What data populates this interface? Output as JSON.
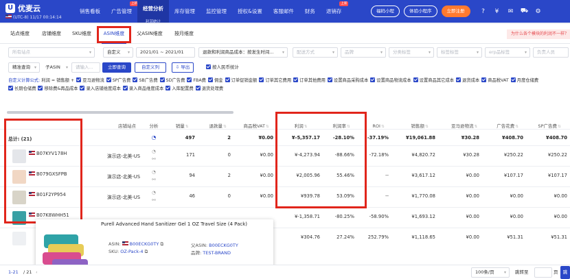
{
  "app": {
    "logo": "优麦云",
    "region_time": "(UTC-8) 11/17 00:14:14",
    "nav": [
      {
        "label": "销售看板"
      },
      {
        "label": "广告管理",
        "tag": "上新"
      },
      {
        "label": "经营分析",
        "sub": "利润统计",
        "active": true
      },
      {
        "label": "库存管理"
      },
      {
        "label": "监控管理"
      },
      {
        "label": "授权&设置"
      },
      {
        "label": "客服邮件"
      },
      {
        "label": "财务"
      },
      {
        "label": "退销存",
        "tag": "上新"
      }
    ],
    "mini_program_btn": "福码小程",
    "trial_btn": "体验小程序",
    "signup_btn": "立即注册"
  },
  "tabs": [
    "站点维度",
    "店铺维度",
    "SKU维度",
    "ASIN维度",
    "父ASIN维度",
    "按月维度"
  ],
  "active_tab": "ASIN维度",
  "help_link": "为什么各个模块的利润不一样？",
  "filters": {
    "site": "所有站点",
    "custom": "自定义",
    "date_from": "2021/01",
    "date_sep": "~",
    "date_to": "2021/01",
    "cost_mode": "退款和利润商品成本：按发生时间...",
    "ship_placeholder": "配送方式",
    "brand_placeholder": "品牌",
    "category_placeholder": "分类标签",
    "tag_placeholder": "标签标签",
    "erp_placeholder": "erp品标签",
    "owner_placeholder": "负责人员",
    "search_mode": "精准查询",
    "search_field": "子ASIN",
    "search_placeholder": "请输入...",
    "query_btn": "立即查询",
    "custom_col_btn": "自定义列",
    "export_btn": "导出",
    "by_asin_stats": "按人民币统计"
  },
  "formula": {
    "title": "自定义计算公式:",
    "items": [
      "利润 = 销售额 +",
      "亚马逊物流",
      "SP广告费",
      "SB广告费",
      "SD广告费",
      "FBA费",
      "佣金",
      "订单促销金额",
      "订单其它费用",
      "订单其他费用",
      "设置商品采购成本",
      "设置商品物流成本",
      "设置商品其它成本",
      "退货成本",
      "商品税VAT",
      "月度仓储费",
      "长期仓储费",
      "移除费&再品成本",
      "录入店铺维度成本",
      "录入商品维度成本",
      "入库配置费",
      "退货处理费"
    ]
  },
  "table": {
    "headers": [
      "",
      "店铺站点",
      "分析",
      "销量",
      "退款量",
      "商品税VAT",
      "利润",
      "利润率",
      "ROI",
      "销售额",
      "亚马逊物流",
      "广告花费",
      "SP广告费"
    ],
    "total_label": "总计: (21)",
    "total": {
      "sales_qty": "497",
      "refund_qty": "2",
      "vat": "¥0.00",
      "profit": "¥-5,357.17",
      "margin": "-28.10%",
      "roi": "-37.19%",
      "revenue": "¥19,061.88",
      "fba": "¥30.28",
      "ad_spend": "¥408.70",
      "sp": "¥408.70"
    },
    "rows": [
      {
        "asin": "B07KYV178H",
        "store": "演示店-北美-US",
        "qty": "171",
        "refund": "0",
        "vat": "¥0.00",
        "profit": "¥-4,273.94",
        "margin": "-88.66%",
        "roi": "-72.18%",
        "revenue": "¥4,820.72",
        "fba": "¥30.28",
        "ad": "¥250.22",
        "sp": "¥250.22"
      },
      {
        "asin": "B079GXSFPB",
        "store": "演示店-北美-US",
        "qty": "94",
        "refund": "2",
        "vat": "¥0.00",
        "profit": "¥2,005.96",
        "margin": "55.46%",
        "roi": "--",
        "revenue": "¥3,617.12",
        "fba": "¥0.00",
        "ad": "¥107.17",
        "sp": "¥107.17"
      },
      {
        "asin": "B01F2YP954",
        "store": "演示店-北美-US",
        "qty": "46",
        "refund": "0",
        "vat": "¥0.00",
        "profit": "¥939.78",
        "margin": "53.09%",
        "roi": "--",
        "revenue": "¥1,770.08",
        "fba": "¥0.00",
        "ad": "¥0.00",
        "sp": "¥0.00"
      },
      {
        "asin": "B07K8WHH51",
        "store": "",
        "qty": "",
        "refund": "",
        "vat": "",
        "profit": "¥-1,358.71",
        "margin": "-80.25%",
        "roi": "-58.90%",
        "revenue": "¥1,693.12",
        "fba": "¥0.00",
        "ad": "¥0.00",
        "sp": "¥0.00"
      },
      {
        "asin": "",
        "store": "",
        "qty": "",
        "refund": "",
        "vat": "",
        "profit": "¥304.76",
        "margin": "27.24%",
        "roi": "252.79%",
        "revenue": "¥1,118.65",
        "fba": "¥0.00",
        "ad": "¥51.31",
        "sp": "¥51.31"
      }
    ]
  },
  "popup": {
    "title": "Purell Advanced Hand Sanitizer Gel 1 OZ Travel Size (4 Pack)",
    "asin_label": "ASIN:",
    "asin": "B00ECKG0TY",
    "parent_label": "父ASIN:",
    "parent_asin": "B00ECKG0TY",
    "sku_label": "SKU:",
    "sku": "OZ-Pack-4",
    "brand_label": "品牌:",
    "brand": "TEST-BRAND"
  },
  "footer": {
    "range": "1-21",
    "total": "/ 21",
    "page_size": "100条/页",
    "jump_label": "跳转至",
    "page_suffix": "页",
    "go_btn": "跳"
  },
  "colors": {
    "primary": "#2a47c8",
    "highlight": "#e1251b",
    "signup": "#ff7a2f"
  }
}
